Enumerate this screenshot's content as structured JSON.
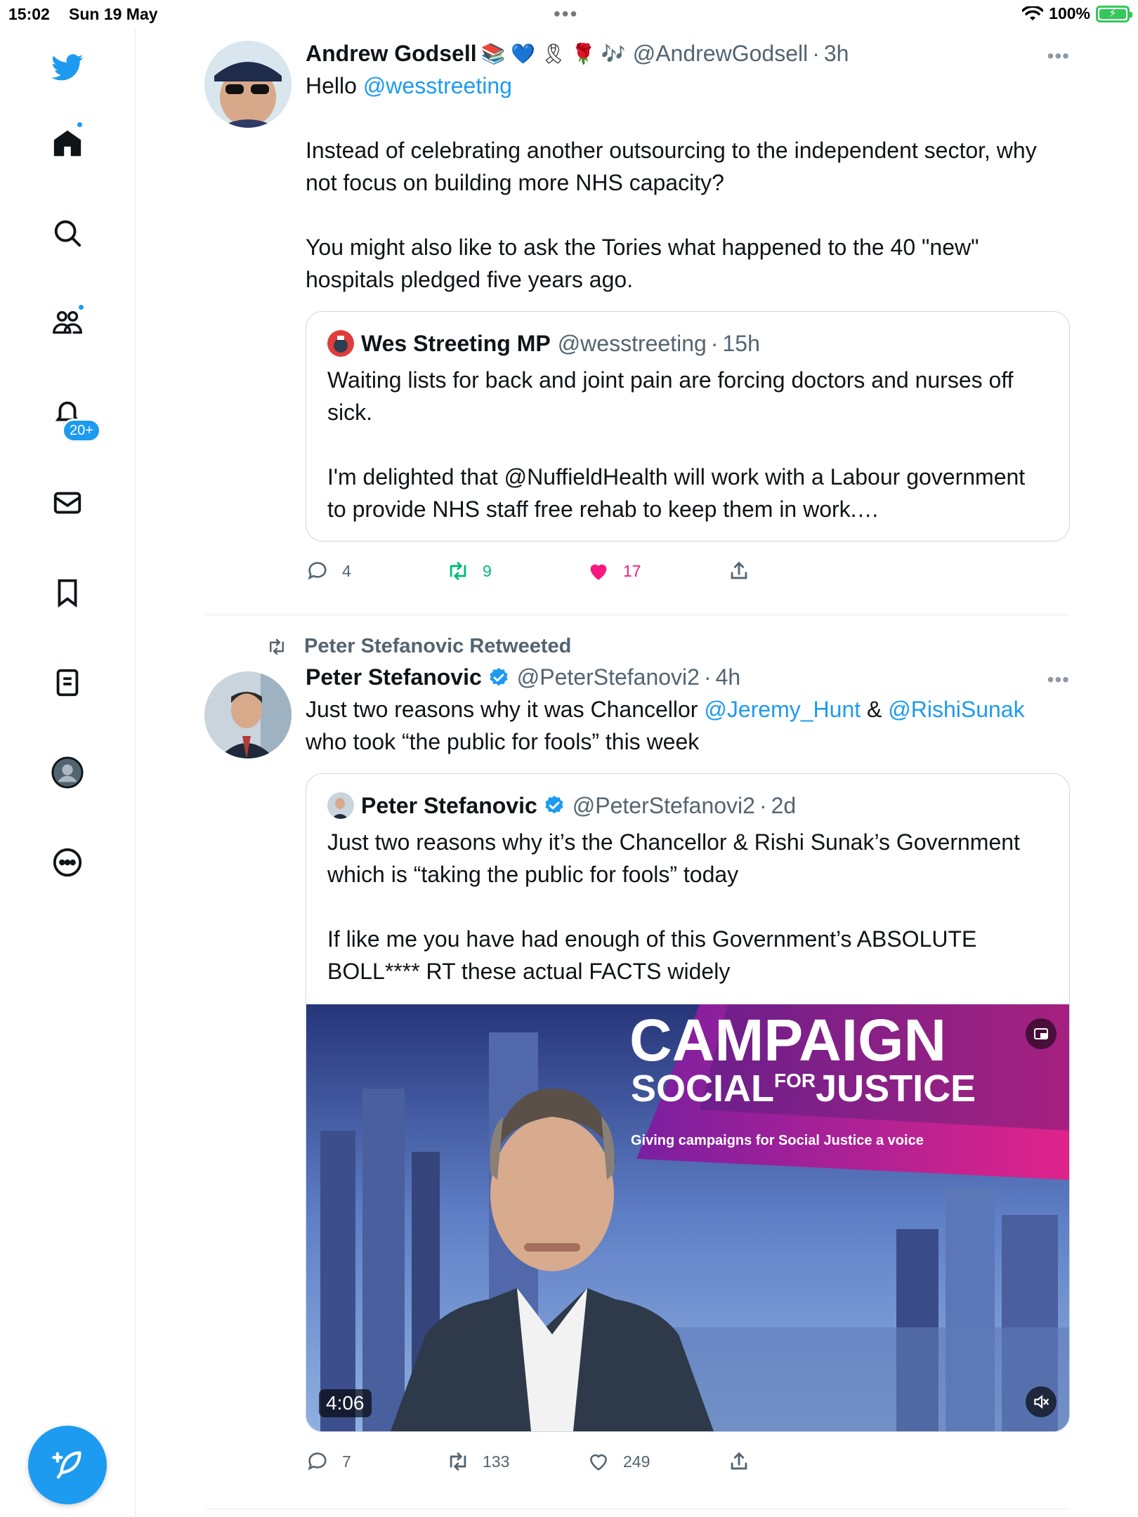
{
  "status_bar": {
    "time": "15:02",
    "date": "Sun 19 May",
    "battery": "100%"
  },
  "sidebar": {
    "notifications_count": "20+"
  },
  "tweets": [
    {
      "name": "Andrew Godsell",
      "emojis": "📚 💙 🎗 🌹 🎶",
      "handle": "@AndrewGodsell",
      "time": "3h",
      "text_1a": "Hello ",
      "text_1b": "@wesstreeting",
      "text_2": "Instead of celebrating another outsourcing to the independent sector, why not focus on building more NHS capacity?",
      "text_3": "You might also like to ask the Tories what happened to the 40 \"new\" hospitals pledged five years ago.",
      "quote": {
        "name": "Wes Streeting MP",
        "handle": "@wesstreeting",
        "time": "15h",
        "text_1": "Waiting lists for back and joint pain are forcing doctors and nurses off sick.",
        "text_2": "I'm delighted that @NuffieldHealth will work with a Labour government to provide NHS staff free rehab to keep them in work.…"
      },
      "replies": "4",
      "retweets": "9",
      "likes": "17"
    },
    {
      "retweeted_by": "Peter Stefanovic Retweeted",
      "name": "Peter Stefanovic",
      "handle": "@PeterStefanovi2",
      "time": "4h",
      "text_a": "Just two reasons why it was Chancellor ",
      "mention_1": "@Jeremy_Hunt",
      "text_b": " & ",
      "mention_2": "@RishiSunak",
      "text_c": "who took “the public for fools” this week",
      "quote": {
        "name": "Peter Stefanovic",
        "handle": "@PeterStefanovi2",
        "time": "2d",
        "text_1": "Just two reasons why it’s the Chancellor & Rishi Sunak’s Government which is “taking the public for fools” today",
        "text_2": "If like me you have had enough of this Government’s ABSOLUTE BOLL**** RT these actual FACTS widely",
        "video": {
          "banner_line1": "CAMPAIGN",
          "banner_line2a": "SOCIAL",
          "banner_line2b": "FOR",
          "banner_line2c": "JUSTICE",
          "banner_tagline": "Giving campaigns for Social Justice a voice",
          "duration": "4:06"
        }
      },
      "replies": "7",
      "retweets": "133",
      "likes": "249"
    }
  ],
  "colors": {
    "accent": "#1d9bf0",
    "like": "#f91880",
    "retweet": "#00ba7c",
    "muted": "#536471"
  }
}
